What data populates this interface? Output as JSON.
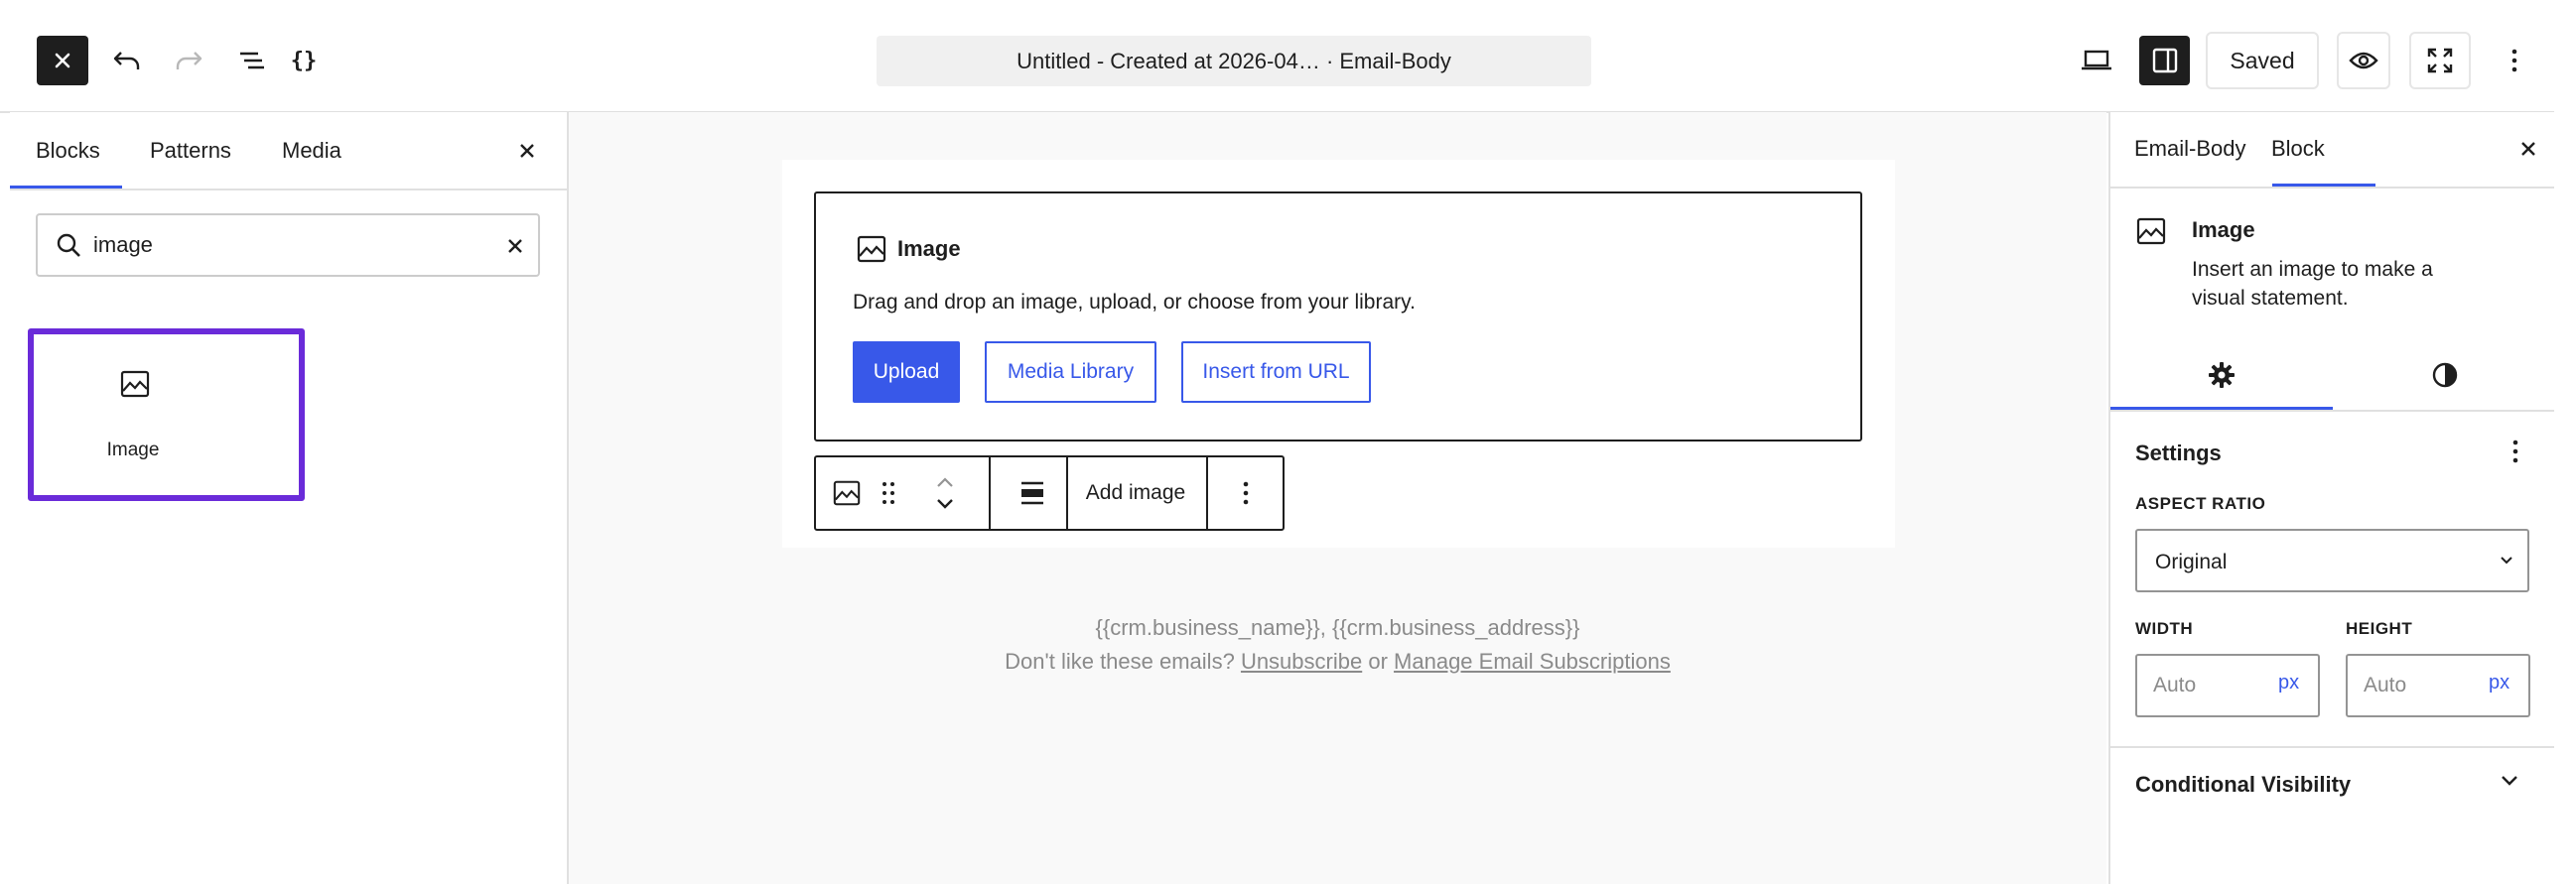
{
  "topbar": {
    "document_title": "Untitled - Created at 2026-04… · Email-Body",
    "saved_label": "Saved",
    "code_editor_glyph": "{}"
  },
  "inserter": {
    "tabs": [
      "Blocks",
      "Patterns",
      "Media"
    ],
    "active_tab": "Blocks",
    "search": {
      "value": "image"
    },
    "results": [
      {
        "label": "Image",
        "icon": "image-icon"
      }
    ]
  },
  "canvas": {
    "placeholder": {
      "title": "Image",
      "instructions": "Drag and drop an image, upload, or choose from your library.",
      "buttons": {
        "upload": "Upload",
        "media_library": "Media Library",
        "insert_url": "Insert from URL"
      }
    },
    "toolbar": {
      "add_image": "Add image"
    },
    "footer": {
      "line1": "{{crm.business_name}}, {{crm.business_address}}",
      "line2_prefix": "Don't like these emails?",
      "unsubscribe": "Unsubscribe",
      "or": "or",
      "manage": "Manage Email Subscriptions"
    }
  },
  "sidebar": {
    "tabs": [
      "Email-Body",
      "Block"
    ],
    "active_tab": "Block",
    "block_card": {
      "title": "Image",
      "description": "Insert an image to make a visual statement."
    },
    "settings": {
      "title": "Settings",
      "aspect_ratio": {
        "label": "ASPECT RATIO",
        "value": "Original"
      },
      "width": {
        "label": "WIDTH",
        "placeholder": "Auto",
        "unit": "px"
      },
      "height": {
        "label": "HEIGHT",
        "placeholder": "Auto",
        "unit": "px"
      }
    },
    "conditional_visibility": {
      "title": "Conditional Visibility"
    }
  },
  "colors": {
    "accent": "#3858e9",
    "highlight": "#6a2bd9",
    "dark": "#1e1e1e",
    "canvas_bg": "#f9f9f9",
    "muted_text": "#8a8a8a"
  }
}
